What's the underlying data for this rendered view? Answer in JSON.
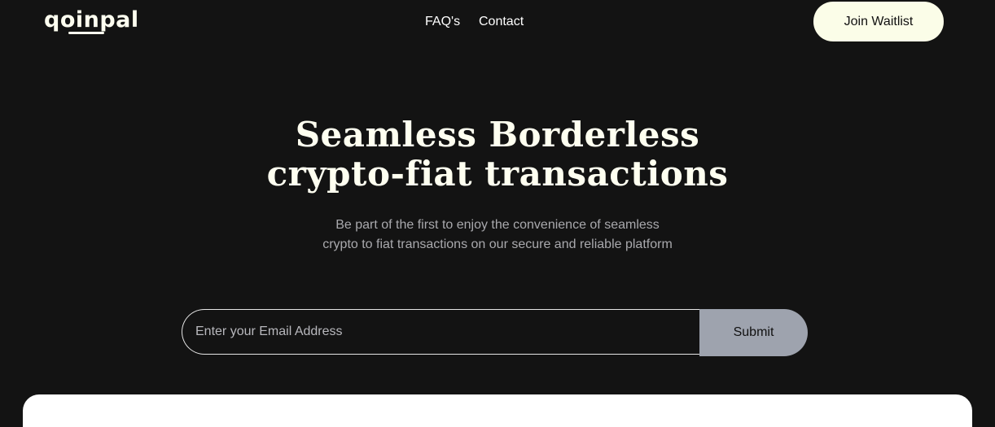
{
  "header": {
    "logo_text": "qoinpal",
    "nav": [
      {
        "label": "FAQ's"
      },
      {
        "label": "Contact"
      }
    ],
    "cta_label": "Join Waitlist"
  },
  "hero": {
    "title_line1": "Seamless Borderless",
    "title_line2": "crypto-fiat transactions",
    "subtitle_line1": "Be part of the first to enjoy the convenience of seamless",
    "subtitle_line2": "crypto to fiat transactions on our secure and reliable platform"
  },
  "signup": {
    "email_placeholder": "Enter your Email Address",
    "email_value": "",
    "submit_label": "Submit"
  },
  "colors": {
    "background": "#131313",
    "accent_cream": "#fefff0",
    "button_cream": "#fbfde8",
    "submit_gray": "#9ea3ae",
    "subtitle_gray": "#a9a9ad"
  }
}
